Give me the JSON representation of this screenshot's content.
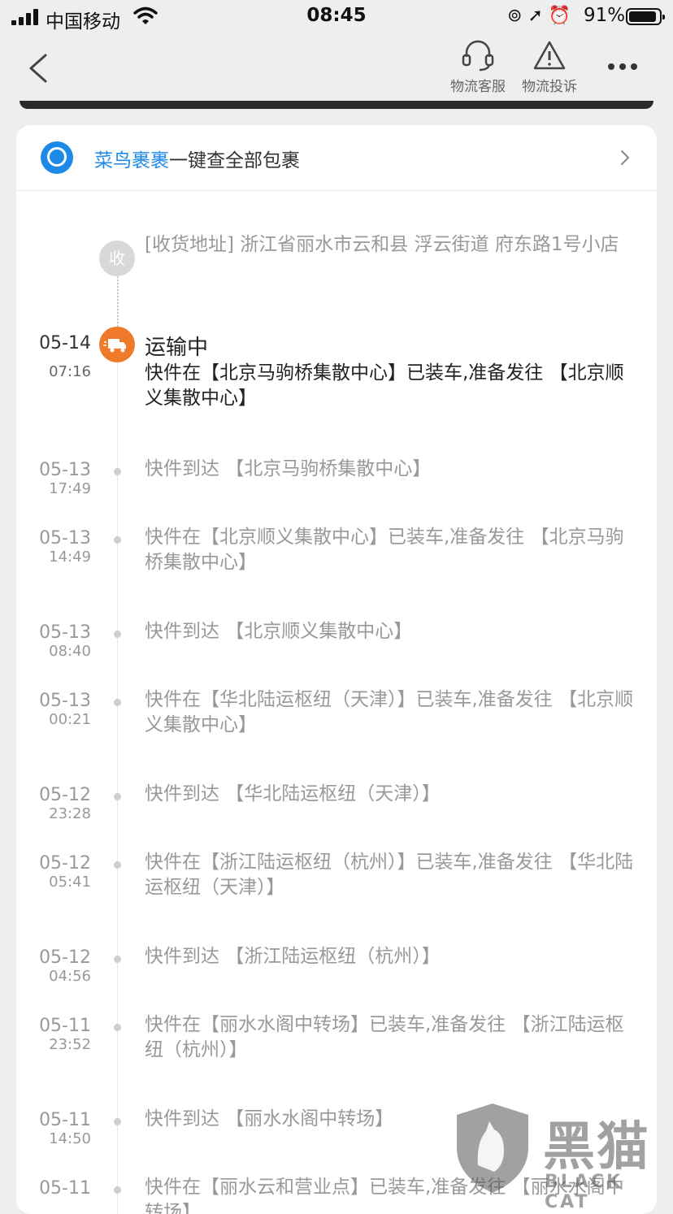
{
  "status": {
    "carrier": "中国移动",
    "time": "08:45",
    "battery": "91%",
    "battery_level": 0.91
  },
  "nav": {
    "service_label": "物流客服",
    "complaint_label": "物流投诉"
  },
  "cainiao": {
    "brand": "菜鸟裹裹",
    "text": "一键查全部包裹"
  },
  "address": {
    "badge": "收",
    "text": "[收货地址] 浙江省丽水市云和县  浮云街道   府东路1号小店"
  },
  "current": {
    "date": "05-14",
    "time": "07:16",
    "status": "运输中",
    "desc": "快件在【北京马驹桥集散中心】已装车,准备发往 【北京顺义集散中心】"
  },
  "events": [
    {
      "date": "05-13",
      "time": "17:49",
      "text": "快件到达 【北京马驹桥集散中心】"
    },
    {
      "date": "05-13",
      "time": "14:49",
      "text": "快件在【北京顺义集散中心】已装车,准备发往 【北京马驹桥集散中心】"
    },
    {
      "date": "05-13",
      "time": "08:40",
      "text": "快件到达 【北京顺义集散中心】"
    },
    {
      "date": "05-13",
      "time": "00:21",
      "text": "快件在【华北陆运枢纽（天津）】已装车,准备发往 【北京顺义集散中心】"
    },
    {
      "date": "05-12",
      "time": "23:28",
      "text": "快件到达 【华北陆运枢纽（天津）】"
    },
    {
      "date": "05-12",
      "time": "05:41",
      "text": "快件在【浙江陆运枢纽（杭州）】已装车,准备发往 【华北陆运枢纽（天津）】"
    },
    {
      "date": "05-12",
      "time": "04:56",
      "text": "快件到达 【浙江陆运枢纽（杭州）】"
    },
    {
      "date": "05-11",
      "time": "23:52",
      "text": "快件在【丽水水阁中转场】已装车,准备发往 【浙江陆运枢纽（杭州）】"
    },
    {
      "date": "05-11",
      "time": "14:50",
      "text": "快件到达 【丽水水阁中转场】"
    },
    {
      "date": "05-11",
      "time": "",
      "text": "快件在【丽水云和营业点】已装车,准备发往 【丽水水阁中转场】"
    }
  ],
  "watermark": {
    "cn": "黑猫",
    "en": "BLACK CAT"
  }
}
